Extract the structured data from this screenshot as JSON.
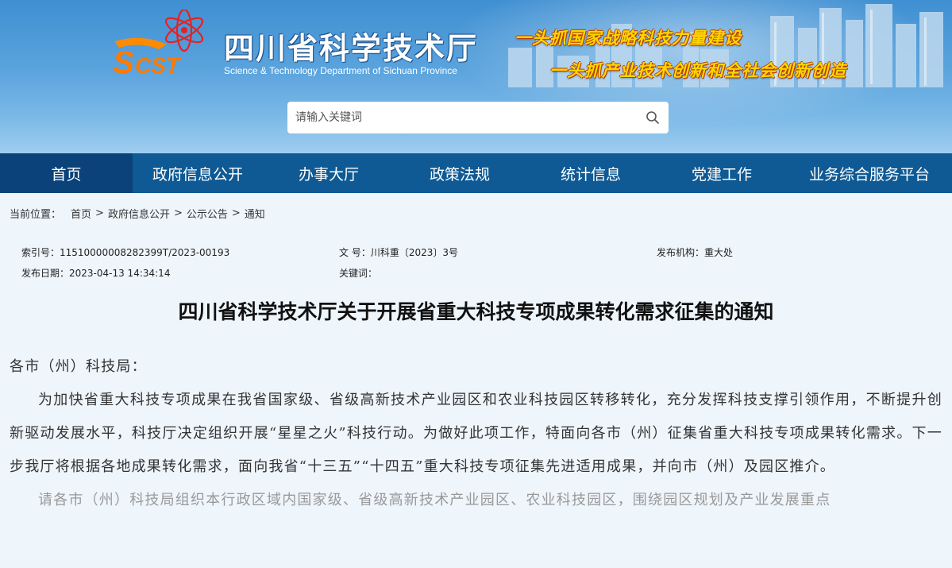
{
  "header": {
    "title": "四川省科学技术厅",
    "subtitle": "Science & Technology Department of Sichuan Province",
    "logo_text": "SCST",
    "slogan_1": "一头抓国家战略科技力量建设",
    "slogan_2": "一头抓产业技术创新和全社会创新创造"
  },
  "search": {
    "placeholder": "请输入关键词"
  },
  "nav": {
    "items": [
      {
        "label": "首页"
      },
      {
        "label": "政府信息公开"
      },
      {
        "label": "办事大厅"
      },
      {
        "label": "政策法规"
      },
      {
        "label": "统计信息"
      },
      {
        "label": "党建工作"
      },
      {
        "label": "业务综合服务平台"
      }
    ]
  },
  "breadcrumb": {
    "label": "当前位置：",
    "items": [
      "首页",
      "政府信息公开",
      "公示公告",
      "通知"
    ]
  },
  "meta": {
    "index_no": "索引号：11510000008282399T/2023-00193",
    "doc_no": "文 号：川科重〔2023〕3号",
    "publisher": "发布机构：重大处",
    "date": "发布日期：2023-04-13 14:34:14",
    "keywords": "关键词："
  },
  "article": {
    "title": "四川省科学技术厅关于开展省重大科技专项成果转化需求征集的通知",
    "salutation": "各市（州）科技局：",
    "para1": "为加快省重大科技专项成果在我省国家级、省级高新技术产业园区和农业科技园区转移转化，充分发挥科技支撑引领作用，不断提升创新驱动发展水平，科技厅决定组织开展“星星之火”科技行动。为做好此项工作，特面向各市（州）征集省重大科技专项成果转化需求。下一步我厅将根据各地成果转化需求，面向我省“十三五”“十四五”重大科技专项征集先进适用成果，并向市（州）及园区推介。",
    "para2": "请各市（州）科技局组织本行政区域内国家级、省级高新技术产业园区、农业科技园区，围绕园区规划及产业发展重点"
  },
  "colors": {
    "nav_bg": "#0f5a94",
    "nav_active": "#0a4279",
    "slogan": "#ffd600",
    "page_bg": "#eef5fb"
  }
}
